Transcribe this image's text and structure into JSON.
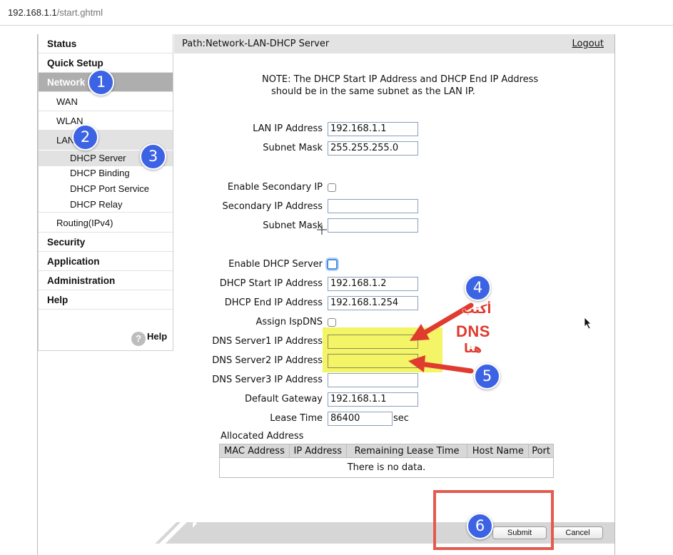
{
  "browser": {
    "url_host": "192.168.1.1",
    "url_path": "/start.ghtml"
  },
  "menu": {
    "status": "Status",
    "quick_setup": "Quick Setup",
    "network": "Network",
    "wan": "WAN",
    "wlan": "WLAN",
    "lan": "LAN",
    "dhcp_server": "DHCP Server",
    "dhcp_binding": "DHCP Binding",
    "dhcp_port_service": "DHCP Port Service",
    "dhcp_relay": "DHCP Relay",
    "routing": "Routing(IPv4)",
    "security": "Security",
    "application": "Application",
    "administration": "Administration",
    "help": "Help",
    "help_link": "Help",
    "help_icon": "?"
  },
  "header": {
    "path": "Path:Network-LAN-DHCP Server",
    "logout": "Logout"
  },
  "note": {
    "line1": "NOTE: The DHCP Start IP Address and DHCP End IP Address",
    "line2": "should be in the same subnet as the LAN IP."
  },
  "form": {
    "lan_ip_label": "LAN IP Address",
    "lan_ip_value": "192.168.1.1",
    "subnet_label": "Subnet Mask",
    "subnet_value": "255.255.255.0",
    "enable_secondary_label": "Enable Secondary IP",
    "secondary_ip_label": "Secondary IP Address",
    "secondary_ip_value": "",
    "secondary_mask_label": "Subnet Mask",
    "secondary_mask_value": "",
    "enable_dhcp_label": "Enable DHCP Server",
    "dhcp_start_label": "DHCP Start IP Address",
    "dhcp_start_value": "192.168.1.2",
    "dhcp_end_label": "DHCP End IP Address",
    "dhcp_end_value": "192.168.1.254",
    "assign_isp_dns_label": "Assign IspDNS",
    "dns1_label": "DNS Server1 IP Address",
    "dns1_value": "",
    "dns2_label": "DNS Server2 IP Address",
    "dns2_value": "",
    "dns3_label": "DNS Server3 IP Address",
    "dns3_value": "",
    "gateway_label": "Default Gateway",
    "gateway_value": "192.168.1.1",
    "lease_label": "Lease Time",
    "lease_value": "86400",
    "lease_unit": "sec"
  },
  "allocated": {
    "title": "Allocated Address",
    "columns": [
      "MAC Address",
      "IP Address",
      "Remaining Lease Time",
      "Host Name",
      "Port"
    ],
    "empty_text": "There is no data."
  },
  "buttons": {
    "submit": "Submit",
    "cancel": "Cancel"
  },
  "annotations": {
    "badges": [
      "1",
      "2",
      "3",
      "4",
      "5",
      "6"
    ],
    "arabic_top": "أكتب",
    "dns": "DNS",
    "arabic_bottom": "هنا",
    "highlight_color": "#f3f566",
    "arrow_color": "#e03b2f",
    "badge_color": "#3d63e5"
  }
}
